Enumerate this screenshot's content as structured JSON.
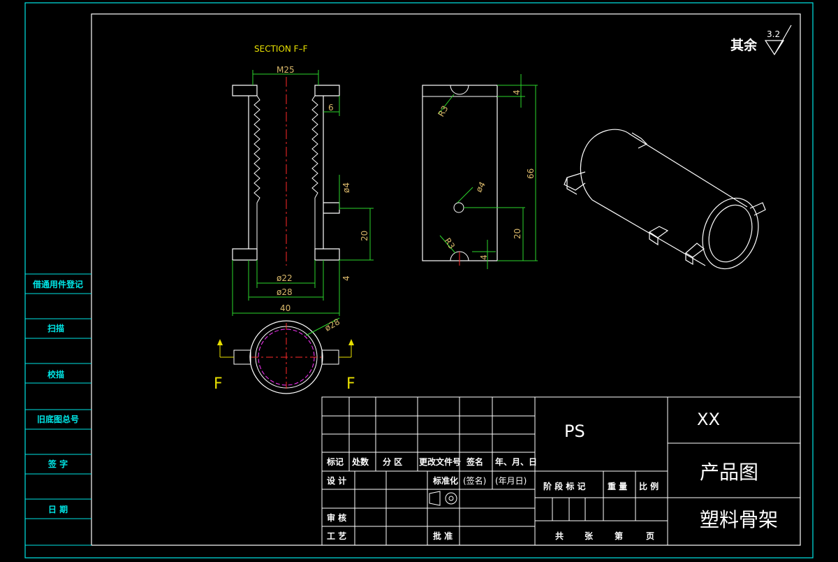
{
  "colors": {
    "background": "#000000",
    "frame": "#00e5e5",
    "outline": "#ffffff",
    "hatch": "#e8e000",
    "centerline": "#ff2a2a",
    "dimension": "#2bd62b",
    "dim_text": "#d9b86a",
    "hidden": "#ff33ff"
  },
  "drawing": {
    "section_label": "SECTION F–F",
    "section_marker": "F",
    "roughness_prefix": "其余",
    "roughness_value": "3.2",
    "dims": {
      "thread": "M25",
      "inner_dia": "ø22",
      "outer_dia": "ø28",
      "overall_width": "40",
      "flange_thick_top": "6",
      "flange_gap": "4",
      "pin_dia": "ø4",
      "pin_spacing": "20",
      "flange_thick_bottom": "4",
      "end_view_dia": "ø28",
      "top_slot_depth": "4",
      "radius_top": "R3",
      "hole_dia": "ø4",
      "height_total": "66",
      "hole_height": "20",
      "radius_bottom": "R3",
      "bottom_slot_depth": "4"
    }
  },
  "left_strip": {
    "labels": [
      "借通用件登记",
      "扫描",
      "校描",
      "旧底图总号",
      "签 字",
      "日 期"
    ]
  },
  "title_block": {
    "material": "PS",
    "company": "XX",
    "drawing_type": "产品图",
    "part_name": "塑料骨架",
    "rev_headers": [
      "标记",
      "处数",
      "分 区",
      "更改文件号",
      "签名",
      "年、月、日"
    ],
    "design": "设 计",
    "standardize": "标准化",
    "sign_paren": "(签名)",
    "date_paren": "(年月日)",
    "review": "审 核",
    "process": "工 艺",
    "approve": "批 准",
    "stage_headers": [
      "阶 段 标 记",
      "重 量",
      "比 例"
    ],
    "sheet_total": "共",
    "sheet_unit": "张",
    "sheet_no": "第",
    "sheet_page": "页"
  }
}
